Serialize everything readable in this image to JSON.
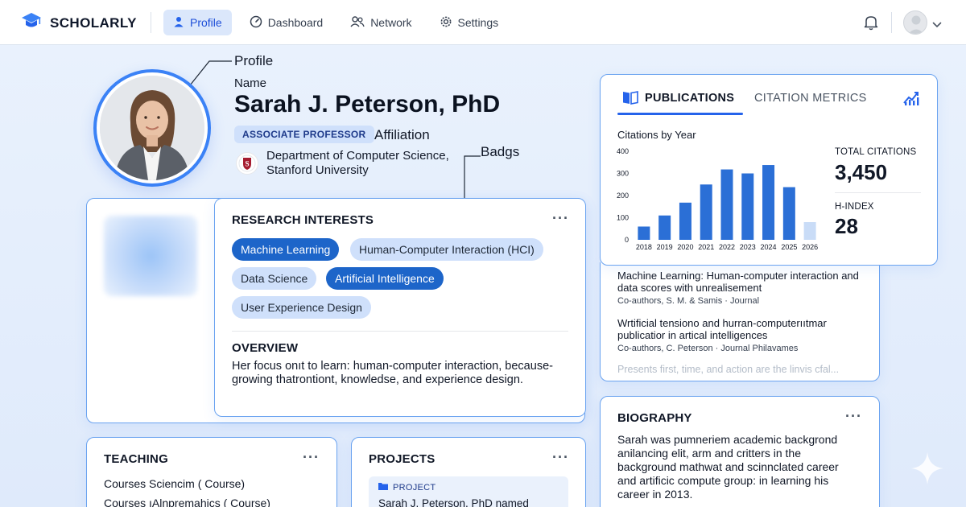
{
  "brand": {
    "name": "SCHOLARLY"
  },
  "nav": {
    "items": [
      {
        "label": "Profile",
        "icon": "user-icon",
        "active": true
      },
      {
        "label": "Dashboard",
        "icon": "dashboard-icon",
        "active": false
      },
      {
        "label": "Network",
        "icon": "people-icon",
        "active": false
      },
      {
        "label": "Settings",
        "icon": "gear-icon",
        "active": false
      }
    ]
  },
  "annotations": {
    "profile": "Profile",
    "affiliation": "Affiliation",
    "badgs": "Badgs"
  },
  "profile": {
    "name_label": "Name",
    "name": "Sarah J. Peterson, PhD",
    "title_badge": "ASSOCIATE PROFESSOR",
    "department": "Department of Computer Science, Stanford University",
    "seal_letter": "S"
  },
  "research": {
    "title": "RESEARCH INTERESTS",
    "more": "···",
    "chips": [
      {
        "label": "Machine Learning",
        "style": "dark"
      },
      {
        "label": "Human-Computer Interaction (HCI)",
        "style": "light"
      },
      {
        "label": "Data Science",
        "style": "light"
      },
      {
        "label": "Artificial Intelligence",
        "style": "dark"
      },
      {
        "label": "User Experience Design",
        "style": "light"
      }
    ],
    "overview_title": "OVERVIEW",
    "overview_text": "Her focus onıt to learn: human-computer interaction, because-growing thatrontiont, knowledse, and experience design."
  },
  "publications": {
    "tabs": [
      "PUBLICATIONS",
      "CITATION METRICS"
    ],
    "active_tab": 0,
    "total_citations_label": "TOTAL CITATIONS",
    "total_citations": "3,450",
    "h_index_label": "H-INDEX",
    "h_index": "28",
    "items": [
      {
        "title": "Machine Learning: Human-computer interaction and data scores with unrealisement",
        "meta": "Co-authors, S. M. & Samis · Journal"
      },
      {
        "title": "Wrtificial tensiono and hurran-computerııtmar publicatior in artical intelligences",
        "meta": "Co-authors, C. Peterson · Journal Philavames"
      }
    ],
    "faded_text": "Presents first, time, and action are the linvis cfal..."
  },
  "chart_data": {
    "type": "bar",
    "title": "Citations by Year",
    "categories": [
      "2018",
      "2019",
      "2020",
      "2021",
      "2022",
      "2023",
      "2024",
      "2025",
      "2026"
    ],
    "values": [
      60,
      110,
      168,
      250,
      318,
      300,
      338,
      238,
      80
    ],
    "highlight_last": true,
    "ylim": [
      0,
      400
    ],
    "yticks": [
      0,
      100,
      200,
      300,
      400
    ],
    "grid": false,
    "colors": {
      "bar": "#2b6fd6",
      "bar_faded": "#c9dcf7"
    }
  },
  "biography": {
    "title": "BIOGRAPHY",
    "text": "Sarah was pumneriem academic backgrond anilancing elit, arm and critters in the background mathwat and scinnclated career and artificic compute group: in learning his career in 2013."
  },
  "teaching": {
    "title": "TEACHING",
    "lines": [
      "Courses Sciencim ( Course)",
      "Courses ıAlnpremahics ( Course)"
    ]
  },
  "projects": {
    "title": "PROJECTS",
    "tag": "PROJECT",
    "text": "Sarah J. Peterson, PhD named"
  },
  "colors": {
    "accent": "#2563eb",
    "card_border": "#6aa3f0",
    "chip_dark": "#1d65c9",
    "chip_light": "#cfe0fb"
  }
}
